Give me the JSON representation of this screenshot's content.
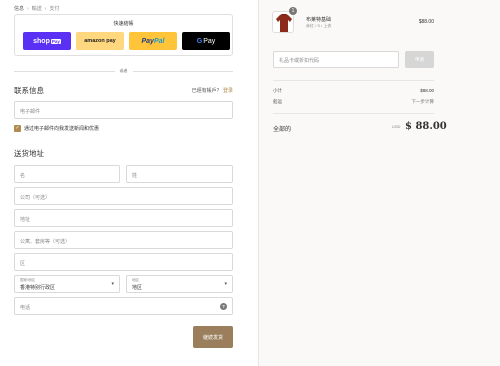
{
  "breadcrumb": {
    "info": "信息",
    "shipping": "輸送",
    "payment": "支付"
  },
  "express": {
    "title": "快速結帳",
    "shoppay": "shop",
    "shoppay_badge": "Pay",
    "amazon": "amazon pay",
    "paypal_a": "Pay",
    "paypal_b": "Pal",
    "gpay_g": "G",
    "gpay": "Pay"
  },
  "or_text": "或者",
  "contact": {
    "title": "联系信息",
    "login_prompt": "已經有帳戶？",
    "login_link": "登录",
    "email_placeholder": "电子邮件",
    "newsletter_label": "通过电子邮件向我发送新闻和优惠",
    "newsletter_checked": true
  },
  "shipping": {
    "title": "送货地址",
    "first_name_placeholder": "名",
    "last_name_placeholder": "姓",
    "company_placeholder": "公司（可选）",
    "address_placeholder": "地址",
    "apartment_placeholder": "公寓、套房等（可选）",
    "district_placeholder": "区",
    "country_label": "国家/地区",
    "country_value": "香港特别行政区",
    "region_label": "地区",
    "region_value": "地区",
    "phone_placeholder": "电话"
  },
  "continue_label": "継続发货",
  "cart": {
    "product_name": "布莱特基础",
    "product_variant": "赤红 / S / 上衣",
    "product_price": "$88.00",
    "quantity": "1"
  },
  "discount": {
    "placeholder": "礼品卡或折扣代码",
    "apply_label": "申请"
  },
  "summary": {
    "subtotal_label": "小计",
    "subtotal_value": "$88.00",
    "shipping_label": "船运",
    "shipping_value": "下一步计算",
    "total_label": "全部的",
    "total_currency": "USD",
    "total_value": "$ 88.00"
  },
  "colors": {
    "accent": "#b08a4f",
    "continue_button": "#9b7f5c",
    "shoppay": "#5a31f4",
    "amazon": "#fed77e",
    "paypal": "#ffc439",
    "gpay": "#000000",
    "product": "#8c2a1c"
  },
  "icons": {
    "breadcrumb_separator": "chevron-right-icon",
    "select": "chevron-down-icon",
    "help": "question-circle-icon",
    "checkbox": "checkmark-icon"
  }
}
